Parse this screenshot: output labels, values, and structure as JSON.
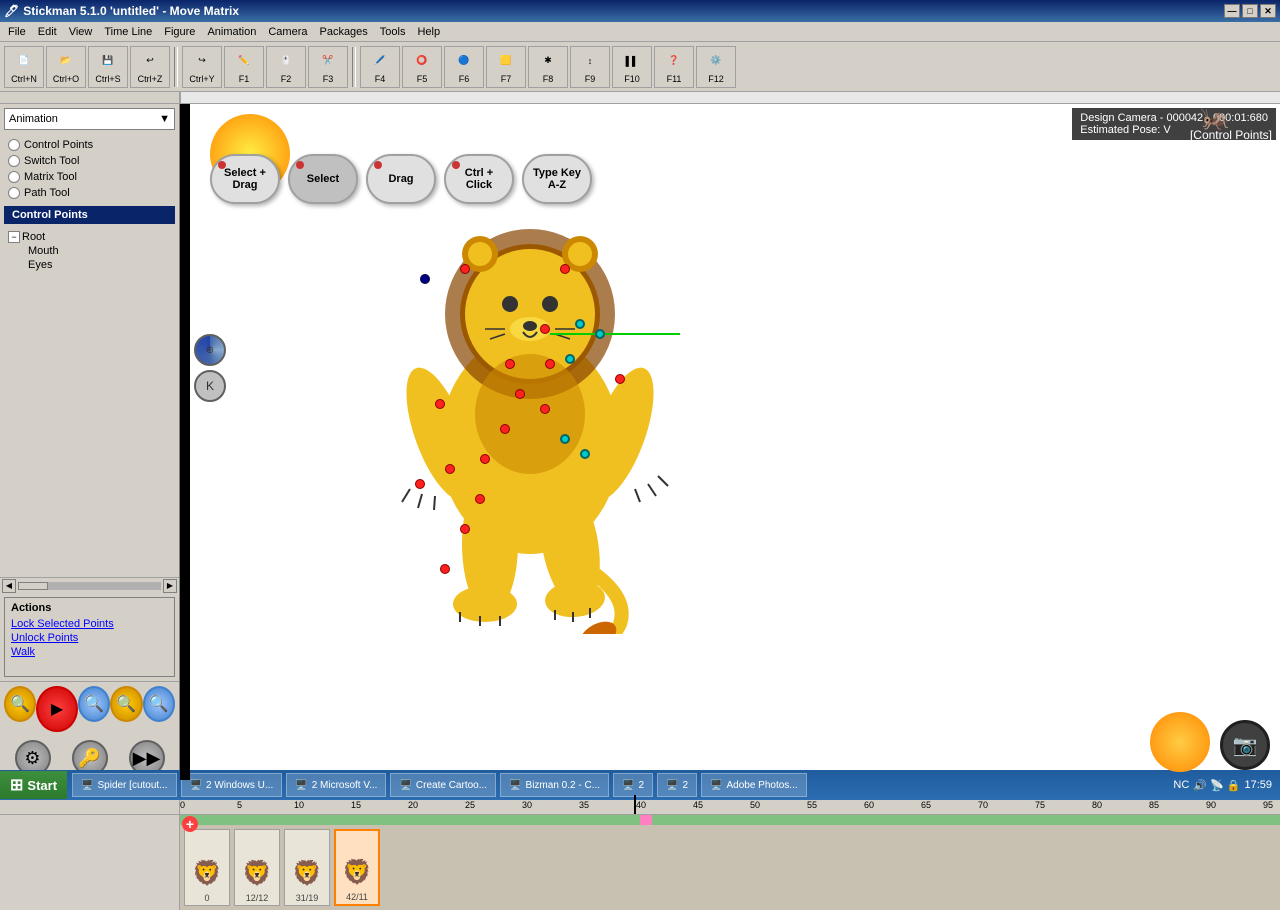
{
  "titlebar": {
    "title": "Stickman 5.1.0  'untitled' - Move Matrix",
    "minimize": "—",
    "maximize": "□",
    "close": "✕"
  },
  "menubar": {
    "items": [
      "File",
      "Edit",
      "View",
      "Time Line",
      "Figure",
      "Animation",
      "Camera",
      "Packages",
      "Tools",
      "Help"
    ]
  },
  "toolbar": {
    "buttons": [
      {
        "label": "Ctrl+N",
        "icon": "new"
      },
      {
        "label": "Ctrl+O",
        "icon": "open"
      },
      {
        "label": "Ctrl+S",
        "icon": "save"
      },
      {
        "label": "Ctrl+Z",
        "icon": "undo"
      },
      {
        "label": "Ctrl+Y",
        "icon": "redo"
      },
      {
        "label": "F1",
        "icon": "brush"
      },
      {
        "label": "F2",
        "icon": "cursor"
      },
      {
        "label": "F3",
        "icon": "knife"
      },
      {
        "label": "F4",
        "icon": "marker"
      },
      {
        "label": "F5",
        "icon": "circle"
      },
      {
        "label": "F6",
        "icon": "oval"
      },
      {
        "label": "F7",
        "icon": "square"
      },
      {
        "label": "F8",
        "icon": "star"
      },
      {
        "label": "F9",
        "icon": "arrows"
      },
      {
        "label": "F10",
        "icon": "battery"
      },
      {
        "label": "F11",
        "icon": "question"
      },
      {
        "label": "F12",
        "icon": "settings"
      }
    ]
  },
  "left_panel": {
    "dropdown": "Animation",
    "tools": [
      {
        "label": "Control Points",
        "selected": false
      },
      {
        "label": "Switch Tool",
        "selected": false
      },
      {
        "label": "Matrix Tool",
        "selected": false
      },
      {
        "label": "Path Tool",
        "selected": false
      }
    ],
    "control_points_active": "Control Points",
    "tree": {
      "root": "Root",
      "children": [
        "Mouth",
        "Eyes"
      ]
    },
    "actions_title": "Actions",
    "actions": [
      "Lock Selected Points",
      "Unlock Points",
      "Walk"
    ]
  },
  "canvas": {
    "camera_info": "Design Camera - 000042 - 000:01:680",
    "pose_info": "Estimated Pose: V",
    "control_points_label": "[Control Points]",
    "overlay_buttons": [
      {
        "label": "Select +\nDrag",
        "dot_color": "#cc3333"
      },
      {
        "label": "Select",
        "dot_color": "#cc3333"
      },
      {
        "label": "Drag",
        "dot_color": "#cc3333"
      },
      {
        "label": "Ctrl +\nClick",
        "dot_color": "#cc3333"
      },
      {
        "label": "Type Key\nA-Z",
        "dot_color": "none"
      }
    ]
  },
  "timeline": {
    "marks": [
      0,
      5,
      10,
      15,
      20,
      25,
      30,
      35,
      40,
      45,
      50,
      55,
      60,
      65,
      70,
      75,
      80,
      85,
      90,
      95
    ],
    "frames": [
      {
        "label": "0",
        "selected": false
      },
      {
        "label": "12/12",
        "selected": false
      },
      {
        "label": "31/19",
        "selected": false
      },
      {
        "label": "42/11",
        "selected": true
      }
    ]
  },
  "taskbar": {
    "start_label": "Start",
    "items": [
      "Spider [cutout...",
      "2 Windows U...",
      "2 Microsoft V...",
      "Create Cartoo...",
      "Bizman 0.2 - C...",
      "2",
      "2",
      "Adobe Photos..."
    ],
    "nc": "NC",
    "time": "17:59"
  },
  "circle_buttons": [
    {
      "label": "⚙",
      "key": "search"
    },
    {
      "label": "K",
      "key": "keyboard"
    }
  ]
}
